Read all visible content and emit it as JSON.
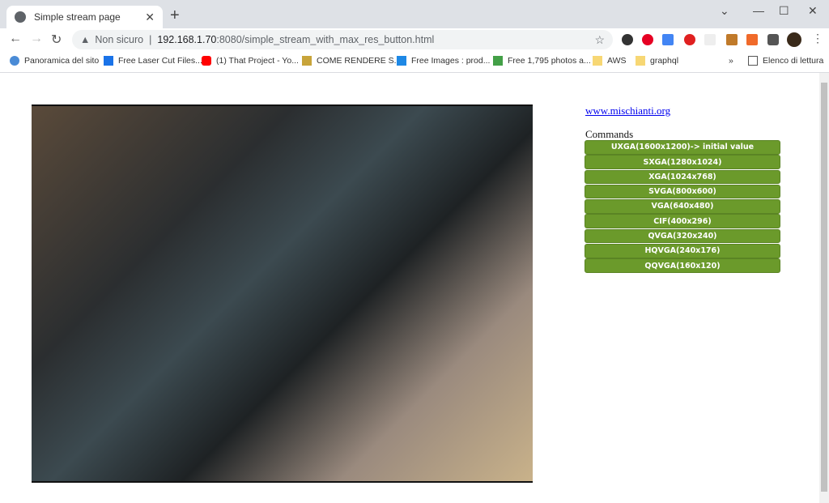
{
  "tab": {
    "title": "Simple stream page"
  },
  "toolbar": {
    "security": "Non sicuro",
    "url_host": "192.168.1.70",
    "url_rest": ":8080/simple_stream_with_max_res_button.html"
  },
  "bookmarks": [
    {
      "label": "Panoramica del sito",
      "color": "#4a8bd6"
    },
    {
      "label": "Free Laser Cut Files...",
      "color": "#1a73e8"
    },
    {
      "label": "(1) That Project - Yo...",
      "color": "#ff0000"
    },
    {
      "label": "COME RENDERE S...",
      "color": "#c8a43a"
    },
    {
      "label": "Free Images : prod...",
      "color": "#1e88e5"
    },
    {
      "label": "Free 1,795 photos a...",
      "color": "#43a047"
    },
    {
      "label": "AWS",
      "color": "#f7d774"
    },
    {
      "label": "graphql",
      "color": "#f7d774"
    }
  ],
  "bookmarks_more": "»",
  "reading_list": "Elenco di lettura",
  "page": {
    "link": "www.mischianti.org",
    "commands_label": "Commands",
    "buttons": [
      "UXGA(1600x1200)-> initial value",
      "SXGA(1280x1024)",
      "XGA(1024x768)",
      "SVGA(800x600)",
      "VGA(640x480)",
      "CIF(400x296)",
      "QVGA(320x240)",
      "HQVGA(240x176)",
      "QQVGA(160x120)"
    ],
    "button_color": "#6b9a2b"
  }
}
